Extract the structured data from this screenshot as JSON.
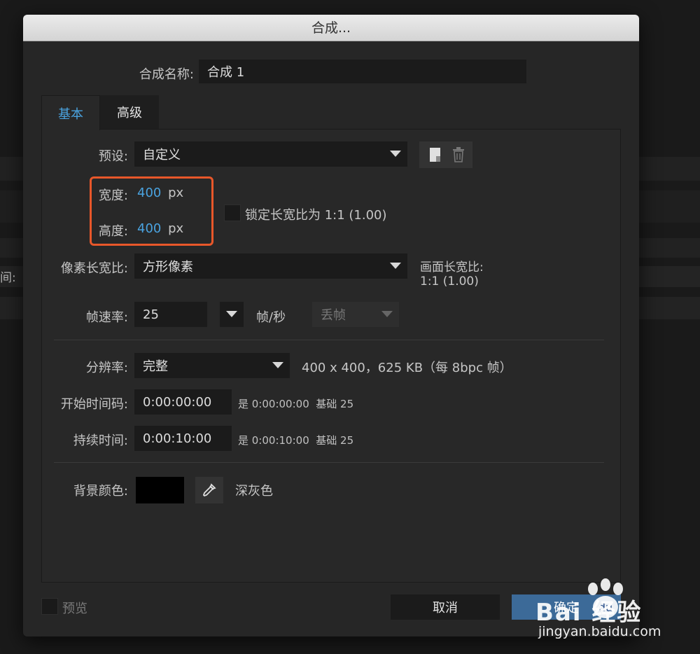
{
  "dialog": {
    "title": "合成...",
    "comp_name_label": "合成名称:",
    "comp_name_value": "合成 1",
    "tabs": [
      {
        "label": "基本",
        "active": true
      },
      {
        "label": "高级",
        "active": false
      }
    ],
    "preset_label": "预设:",
    "preset_value": "自定义",
    "width_label": "宽度:",
    "width_value": "400",
    "width_unit": "px",
    "height_label": "高度:",
    "height_value": "400",
    "height_unit": "px",
    "lock_aspect_label": "锁定长宽比为 1:1 (1.00)",
    "pixel_aspect_label": "像素长宽比:",
    "pixel_aspect_value": "方形像素",
    "frame_aspect_label": "画面长宽比:",
    "frame_aspect_value": "1:1 (1.00)",
    "frame_rate_label": "帧速率:",
    "frame_rate_value": "25",
    "frame_rate_unit": "帧/秒",
    "drop_frame_value": "丢帧",
    "resolution_label": "分辨率:",
    "resolution_value": "完整",
    "resolution_info": "400 x 400，625 KB（每 8bpc 帧）",
    "start_tc_label": "开始时间码:",
    "start_tc_value": "0:00:00:00",
    "start_tc_info": "是 0:00:00:00  基础 25",
    "duration_label": "持续时间:",
    "duration_value": "0:00:10:00",
    "duration_info": "是 0:00:10:00  基础 25",
    "bg_color_label": "背景颜色:",
    "bg_color_name": "深灰色",
    "bg_color_hex": "#000000",
    "preview_label": "预览",
    "cancel_label": "取消",
    "ok_label": "确定"
  },
  "background": {
    "left_label": "间:"
  },
  "watermark": {
    "brand": "Bai 经验",
    "url": "jingyan.baidu.com"
  },
  "colors": {
    "accent_blue": "#4aa3e0",
    "highlight_orange": "#e8572a",
    "ok_button": "#3c6a98"
  }
}
